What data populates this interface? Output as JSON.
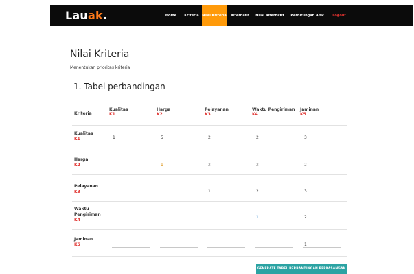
{
  "brand": {
    "name": "Lau",
    "accent": "ak",
    "suffix": "."
  },
  "nav": [
    "Home",
    "Kriteria",
    "Nilai Kriteria",
    "Alternatif",
    "Nilai Alternatif",
    "Perhitungan AHP",
    "Logout"
  ],
  "page": {
    "title": "Nilai Kriteria",
    "subtitle": "Menentukan prioritas kriteria",
    "section": "1. Tabel perbandingan"
  },
  "table": {
    "header": "Kriteria",
    "criteria": [
      {
        "name": "Kualitas",
        "code": "K1"
      },
      {
        "name": "Harga",
        "code": "K2"
      },
      {
        "name": "Pelayanan",
        "code": "K3"
      },
      {
        "name": "Waktu Pengiriman",
        "code": "K4"
      },
      {
        "name": "Jaminan",
        "code": "K5"
      }
    ],
    "rows": [
      [
        "1",
        "5",
        "2",
        "2",
        "3"
      ],
      [
        "",
        "1",
        "2",
        "2",
        "2"
      ],
      [
        "",
        "",
        "1",
        "2",
        "3"
      ],
      [
        "",
        "",
        "",
        "1",
        "2"
      ],
      [
        "",
        "",
        "",
        "",
        "1"
      ]
    ]
  },
  "button": {
    "label": "GENERATE TABEL PERBANDINGAN BERPASANGAN"
  },
  "colors": {
    "navbar": "#0b0b0b",
    "active_nav": "#ff9a0a",
    "accent": "#ff7a1a",
    "code": "#e0322f",
    "button": "#2ba3a3"
  }
}
